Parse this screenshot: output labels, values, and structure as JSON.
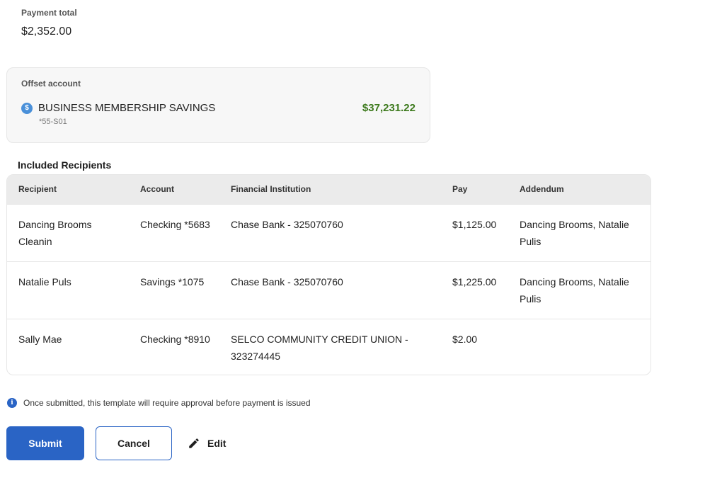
{
  "payment_total": {
    "label": "Payment total",
    "value": "$2,352.00"
  },
  "offset_account": {
    "label": "Offset account",
    "icon": "dollar-circle-icon",
    "name": "BUSINESS MEMBERSHIP SAVINGS",
    "number": "*55-S01",
    "balance": "$37,231.22",
    "balance_color": "#3d7a1d"
  },
  "recipients": {
    "title": "Included Recipients",
    "headers": [
      "Recipient",
      "Account",
      "Financial Institution",
      "Pay",
      "Addendum"
    ],
    "rows": [
      {
        "recipient": "Dancing Brooms Cleanin",
        "account": "Checking *5683",
        "institution": "Chase Bank - 325070760",
        "pay": "$1,125.00",
        "addendum": "Dancing Brooms, Natalie Pulis"
      },
      {
        "recipient": "Natalie Puls",
        "account": "Savings *1075",
        "institution": "Chase Bank - 325070760",
        "pay": "$1,225.00",
        "addendum": "Dancing Brooms, Natalie Pulis"
      },
      {
        "recipient": "Sally Mae",
        "account": "Checking *8910",
        "institution": "SELCO COMMUNITY CREDIT UNION - 323274445",
        "pay": "$2.00",
        "addendum": ""
      }
    ]
  },
  "notice": {
    "icon": "info-icon",
    "text": "Once submitted, this template will require approval before payment is issued"
  },
  "actions": {
    "submit": "Submit",
    "cancel": "Cancel",
    "edit": "Edit",
    "edit_icon": "pencil-icon",
    "accent_color": "#2a64c5"
  }
}
